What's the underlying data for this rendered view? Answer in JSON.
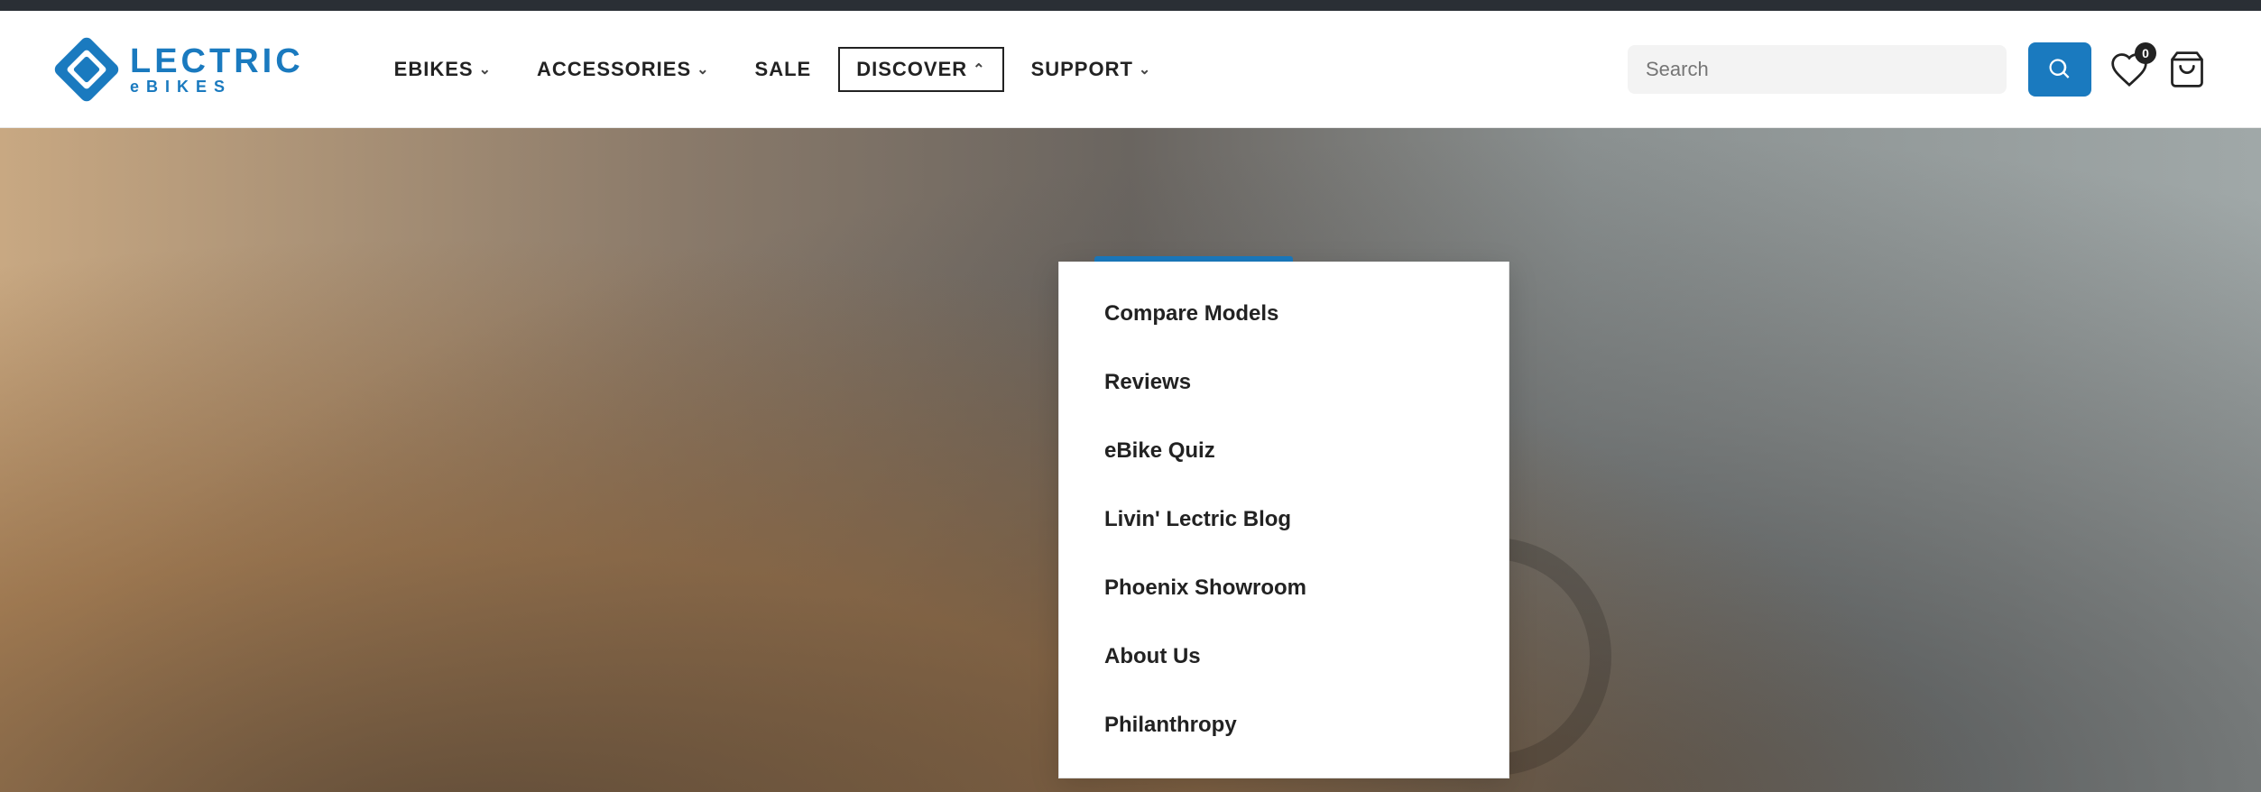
{
  "topbar": {},
  "header": {
    "logo": {
      "text_main": "LECTRIC",
      "text_sub": "eBIKES"
    },
    "nav": {
      "items": [
        {
          "label": "eBIKES",
          "has_dropdown": true,
          "active": false
        },
        {
          "label": "ACCESSORIES",
          "has_dropdown": true,
          "active": false
        },
        {
          "label": "SALE",
          "has_dropdown": false,
          "active": false
        },
        {
          "label": "DISCOVER",
          "has_dropdown": true,
          "active": true
        },
        {
          "label": "SUPPORT",
          "has_dropdown": true,
          "active": false
        }
      ]
    },
    "search": {
      "placeholder": "Search",
      "value": ""
    },
    "wishlist": {
      "badge": "0"
    },
    "cart": {}
  },
  "discover_dropdown": {
    "items": [
      {
        "label": "Compare Models"
      },
      {
        "label": "Reviews"
      },
      {
        "label": "eBike Quiz"
      },
      {
        "label": "Livin' Lectric Blog"
      },
      {
        "label": "Phoenix Showroom"
      },
      {
        "label": "About Us"
      },
      {
        "label": "Philanthropy"
      }
    ]
  }
}
